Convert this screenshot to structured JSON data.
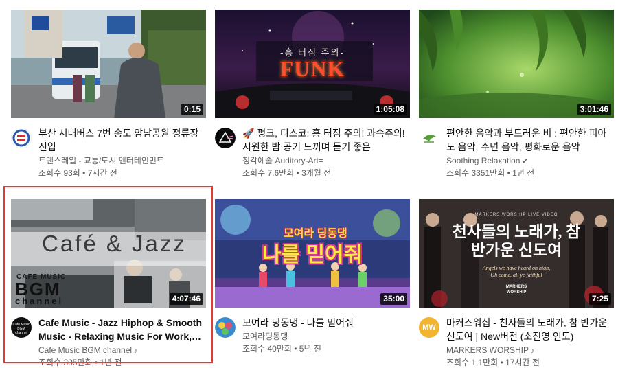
{
  "videos": [
    {
      "title": "부산 시내버스 7번 송도 암남공원 정류장 진입",
      "channel": "트랜스레일 - 교통/도시 엔터테인먼트",
      "views": "조회수 93회",
      "age": "7시간 전",
      "duration": "0:15",
      "verified": false,
      "thumb_text": ""
    },
    {
      "title": "🚀 펑크, 디스코: 흥 터짐 주의! 과속주의! 시원한 밤 공기 느끼며 듣기 좋은",
      "channel": "청각예술 Auditory-Art=",
      "views": "조회수 7.6만회",
      "age": "3개월 전",
      "duration": "1:05:08",
      "verified": false,
      "thumb_text": "FUNK",
      "thumb_subtext": "-흥 터짐 주의-"
    },
    {
      "title": "편안한 음악과 부드러운 비 : 편안한 피아노 음악, 수면 음악, 평화로운 음악",
      "channel": "Soothing Relaxation",
      "views": "조회수 3351만회",
      "age": "1년 전",
      "duration": "3:01:46",
      "verified": true,
      "thumb_text": ""
    },
    {
      "title": "Cafe Music - Jazz Hiphop & Smooth Music - Relaxing Music For Work, Study",
      "channel": "Cafe Music BGM channel",
      "views": "조회수 305만회",
      "age": "1년 전",
      "duration": "4:07:46",
      "verified": false,
      "music_note": true,
      "thumb_text": "Café & Jazz",
      "thumb_subtext": "CAFE MUSIC",
      "thumb_logo_a": "BGM",
      "thumb_logo_b": "channel",
      "avatar_text": "Cafe Music BGM channel"
    },
    {
      "title": "모여라 딩동댕 - 나를 믿어줘",
      "channel": "모여라딩동댕",
      "views": "조회수 40만회",
      "age": "5년 전",
      "duration": "35:00",
      "verified": false,
      "thumb_text": "나를 믿어줘",
      "thumb_subtext": "모여라 딩동댕"
    },
    {
      "title": "마커스워십 - 천사들의 노래가, 참 반가운 신도여 | New버전 (소진영 인도)",
      "channel": "MARKERS WORSHIP",
      "views": "조회수 1.1만회",
      "age": "17시간 전",
      "duration": "7:25",
      "verified": false,
      "music_note": true,
      "thumb_text": "천사들의 노래가, 참 반가운 신도여",
      "thumb_small_top": "MARKERS WORSHIP LIVE VIDEO",
      "thumb_small_en1": "Angels we have heard on high,",
      "thumb_small_en2": "Oh come, all ye faithful",
      "thumb_logo": "MARKERS WORSHIP",
      "avatar_text": "MW"
    }
  ],
  "separator": " • ",
  "verified_icon": "✔",
  "music_icon": "♪",
  "colors": {
    "highlight": "#e53935",
    "meta": "#606060"
  }
}
